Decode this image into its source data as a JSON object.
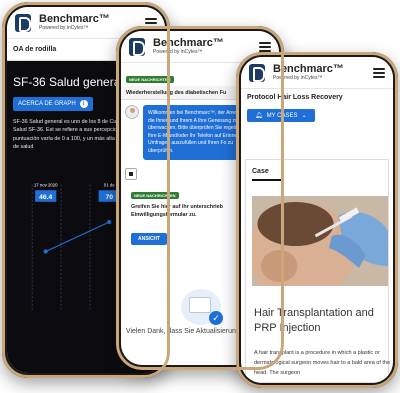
{
  "brand": {
    "name": "Benchmarc™",
    "subtitle": "Powered by inCytes™"
  },
  "phone1": {
    "subbar_title": "OA de rodilla",
    "subbar_button": "",
    "heading": "SF-36 Salud general",
    "graph_button": "ACERCA DE GRAPH",
    "description": "SF-36 Salud general es uno de los 8 de Cuestionario de Salud SF-36. Est se refiere a sus percepciones genera La puntuación varía de 0 a 100, y un más alta define un estado de salud",
    "chart_data": {
      "type": "line",
      "categories": [
        "17 nov 2020",
        "01 de"
      ],
      "values": [
        46.4,
        70
      ],
      "value_labels": [
        "46.4",
        "70"
      ],
      "title": "",
      "xlabel": "",
      "ylabel": ""
    }
  },
  "phone2": {
    "section_title": "Wiederherstellung des diabetischen Fu",
    "badge1": "NEUE NACHRICHTEN",
    "message1": "Willkommen bei Benchmarc™, der Anwendung, die Ihnen und Ihrem A Ihre Genesung zu überwachen. Bitte überprüfen Sie regelmäßig Ihre E-M und/oder Ihr Telefon auf Erinnerung Umfragen auszufüllen und Ihren Fo zu überprüfen.",
    "badge2": "NEUE NACHRICHTEN",
    "message2": "Greifen Sie hier auf ihr unterschrieb Einwilligungsformular zu.",
    "view_button": "ANSICHT",
    "read_text": "Vielen Dank, dass Sie Aktualisierungen gelesen"
  },
  "phone3": {
    "title": "Protocol Hair Loss Recovery",
    "cases_button": "MY CASES",
    "case_label": "Case",
    "case_heading": "Hair Transplantation and PRP Injection",
    "case_text": "A hair transplant is a procedure in which a plastic or dermatological surgeon moves hair to a bald area of the head. The surgeon"
  },
  "colors": {
    "accent": "#1f6fd6",
    "brand_dark": "#1d3a66",
    "badge_green": "#2e7d32",
    "dark_bg": "#0c0c10",
    "frame_gold": "#caa77a"
  }
}
